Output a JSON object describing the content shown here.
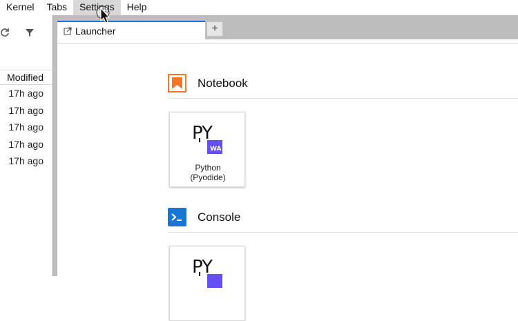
{
  "menubar": {
    "items": [
      "Kernel",
      "Tabs",
      "Settings",
      "Help"
    ],
    "active_item": "Settings"
  },
  "file_browser": {
    "toolbar_icons": [
      "refresh-icon",
      "filter-icon"
    ],
    "column_header": "Modified",
    "rows": [
      "17h ago",
      "17h ago",
      "17h ago",
      "17h ago",
      "17h ago"
    ]
  },
  "tabs": [
    {
      "label": "Launcher",
      "icon": "launcher-icon",
      "active": true
    }
  ],
  "add_tab_label": "+",
  "launcher": {
    "sections": [
      {
        "title": "Notebook",
        "icon": "notebook-icon",
        "icon_color": "#f37726",
        "cards": [
          {
            "label_line1": "Python",
            "label_line2": "(Pyodide)",
            "logo": "pyodide-logo"
          }
        ]
      },
      {
        "title": "Console",
        "icon": "console-icon",
        "icon_color": "#1976d2",
        "cards": [
          {
            "label_line1": "",
            "label_line2": "",
            "logo": "pyodide-logo"
          }
        ]
      }
    ]
  },
  "colors": {
    "accent": "#1976d2",
    "notebook": "#f37726",
    "pyodide_badge": "#654ff0",
    "splitter": "#bdbdbd"
  }
}
